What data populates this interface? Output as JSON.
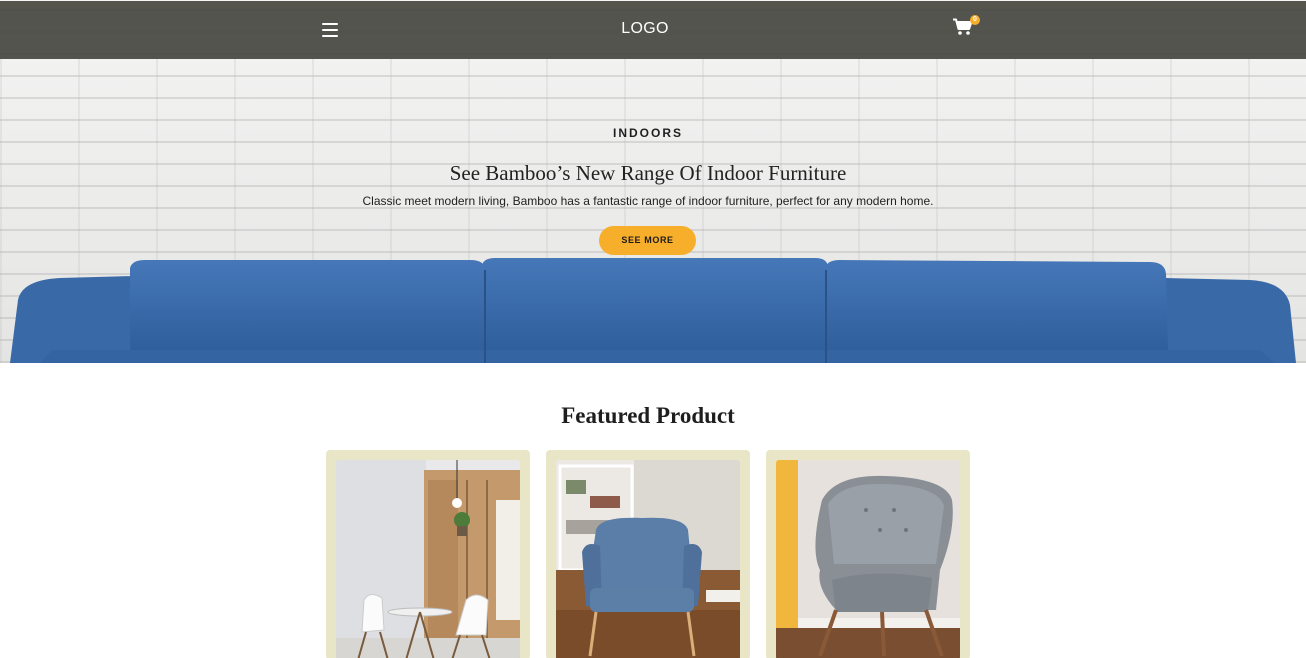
{
  "header": {
    "menu_icon": "hamburger-menu-icon",
    "logo": "LOGO",
    "cart_icon": "shopping-cart-icon",
    "cart_count": "0"
  },
  "hero": {
    "kicker": "INDOORS",
    "title": "See Bamboo’s New Range Of Indoor Furniture",
    "subtitle": "Classic meet modern living, Bamboo has a fantastic range of indoor furniture, perfect for any modern home.",
    "cta_label": "SEE MORE"
  },
  "featured": {
    "title": "Featured Product",
    "products": [
      {
        "image": "dining-room-white-chairs"
      },
      {
        "image": "blue-armchair"
      },
      {
        "image": "grey-wingback-chair"
      }
    ]
  },
  "colors": {
    "header_bg": "#46463f",
    "accent": "#f7ae2b",
    "card_bg": "#e8e6c6",
    "sofa": "#3c6eae"
  }
}
